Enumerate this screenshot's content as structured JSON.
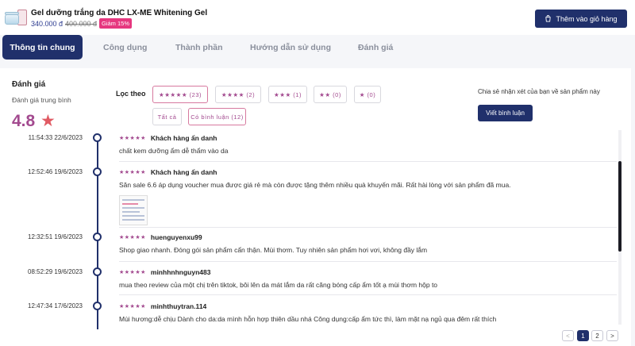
{
  "product": {
    "name": "Gel dưỡng trắng da DHC LX-ME Whitening Gel",
    "price": "340.000 đ",
    "old_price": "400.000 đ",
    "discount": "Giảm 15%",
    "cart_button": "Thêm vào giỏ hàng"
  },
  "tabs": [
    "Thông tin chung",
    "Công dụng",
    "Thành phần",
    "Hướng dẫn sử dụng",
    "Đánh giá"
  ],
  "reviews_summary": {
    "title": "Đánh giá",
    "subtitle": "Đánh giá trung bình",
    "score": "4.8",
    "star": "★"
  },
  "filter": {
    "label": "Lọc theo",
    "chips": [
      "★★★★★ (23)",
      "★★★★ (2)",
      "★★★ (1)",
      "★★ (0)",
      "★ (0)",
      "Tất cả",
      "Có bình luận (12)"
    ]
  },
  "share": {
    "text": "Chia sẻ nhận xét của bạn về sản phẩm này",
    "button": "Viết bình luận"
  },
  "reviews": [
    {
      "time": "11:54:33 22/6/2023",
      "stars": "★★★★★",
      "author": "Khách hàng ẩn danh",
      "text": "chất kem dưỡng ẩm dễ thẩm vào da"
    },
    {
      "time": "12:52:46 19/6/2023",
      "stars": "★★★★★",
      "author": "Khách hàng ẩn danh",
      "text": "Săn sale 6.6 áp dụng voucher mua được giá rẻ mà còn được tặng thêm nhiều quà khuyến mãi. Rất hài lòng với sản phẩm đã mua."
    },
    {
      "time": "12:32:51 19/6/2023",
      "stars": "★★★★★",
      "author": "huenguyenxu99",
      "text": "Shop giao nhanh. Đóng gói sản phẩm cẩn thận. Mùi thơm. Tuy nhiên sản phẩm hơi vơi, không đầy lắm"
    },
    {
      "time": "08:52:29 19/6/2023",
      "stars": "★★★★★",
      "author": "minhhnhnguyn483",
      "text": "mua theo review của một chị trên tiktok, bôi lên da mát lắm da rất căng bóng cấp ẩm tốt ạ mùi thơm hộp to"
    },
    {
      "time": "12:47:34 17/6/2023",
      "stars": "★★★★★",
      "author": "minhthuytran.114",
      "text": "Mùi hương:dễ chịu Dành cho da:da mình hỗn hợp thiên dầu nhá Công dụng:cấp ẩm tức thì, làm mặt nạ ngủ qua đêm rất thích"
    }
  ],
  "pagination": {
    "prev": "<",
    "pages": [
      "1",
      "2"
    ],
    "next": ">"
  },
  "colors": {
    "navy": "#20306b",
    "accent": "#a34a8f",
    "badge": "#e6377f",
    "star": "#e05a63"
  }
}
